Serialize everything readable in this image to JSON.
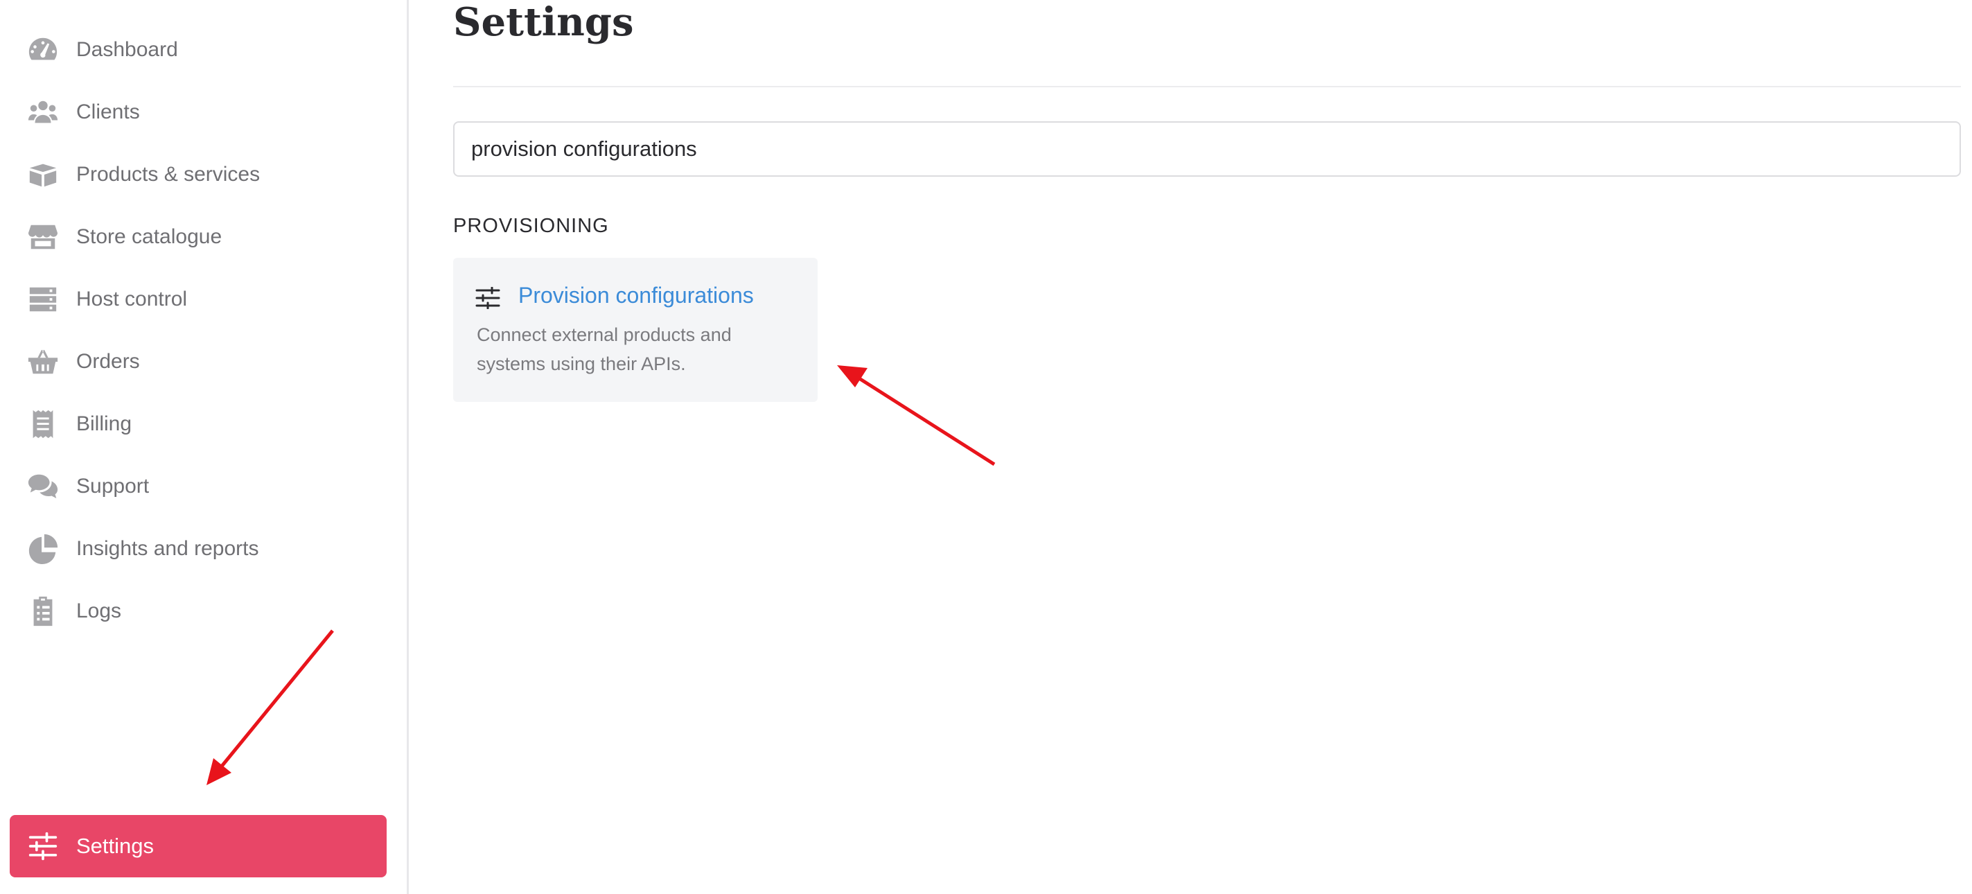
{
  "sidebar": {
    "items": [
      {
        "label": "Dashboard",
        "icon": "dashboard-icon"
      },
      {
        "label": "Clients",
        "icon": "users-icon"
      },
      {
        "label": "Products & services",
        "icon": "box-open-icon"
      },
      {
        "label": "Store catalogue",
        "icon": "store-icon"
      },
      {
        "label": "Host control",
        "icon": "server-icon"
      },
      {
        "label": "Orders",
        "icon": "basket-icon"
      },
      {
        "label": "Billing",
        "icon": "receipt-icon"
      },
      {
        "label": "Support",
        "icon": "comments-icon"
      },
      {
        "label": "Insights and reports",
        "icon": "pie-chart-icon"
      },
      {
        "label": "Logs",
        "icon": "clipboard-list-icon"
      }
    ],
    "active": {
      "label": "Settings",
      "icon": "sliders-icon"
    }
  },
  "main": {
    "title": "Settings",
    "search": {
      "value": "provision configurations"
    },
    "section": "PROVISIONING",
    "result": {
      "title": "Provision configurations",
      "description": "Connect external products and systems using their APIs.",
      "icon": "sliders-icon"
    }
  },
  "colors": {
    "active_bg": "#e84667",
    "link": "#3b8bd8",
    "annotation_arrow": "#e8141b"
  }
}
